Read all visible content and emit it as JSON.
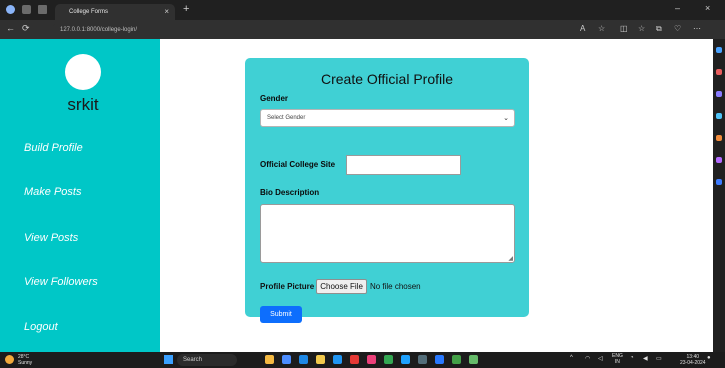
{
  "browser": {
    "tab_title": "College Forms",
    "tab_close": "×",
    "new_tab": "+",
    "url": "127.0.0.1:8000/college-login/",
    "back": "←",
    "refresh": "⟳",
    "window_minimize": "–",
    "window_close": "×"
  },
  "sidebar": {
    "brand": "srkit",
    "links": [
      "Build Profile",
      "Make Posts",
      "View Posts",
      "View Followers",
      "Logout"
    ]
  },
  "form": {
    "title": "Create Official Profile",
    "gender_label": "Gender",
    "gender_value": "Select Gender",
    "site_label": "Official College Site",
    "bio_label": "Bio Description",
    "picture_label": "Profile Picture",
    "file_button": "Choose File",
    "file_status": "No file chosen",
    "submit": "Submit"
  },
  "taskbar": {
    "weather_temp": "28°C",
    "weather_desc": "Sunny",
    "search": "Search",
    "lang_1": "ENG",
    "lang_2": "IN",
    "time": "13:40",
    "date": "23-04-2024"
  },
  "colors": {
    "sidebar": "#00c7c7",
    "card": "#40d0d4",
    "submit": "#0d6efd"
  }
}
